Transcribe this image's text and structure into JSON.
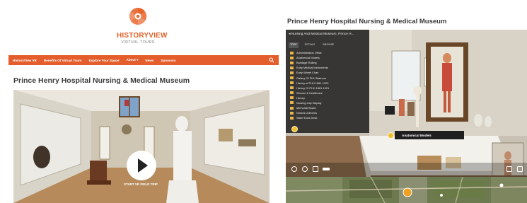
{
  "left": {
    "logo": {
      "name": "HISTORYVIEW",
      "tagline": "VIRTUAL TOURS"
    },
    "nav": {
      "items": [
        "HistoryView VR",
        "Benefits Of Virtual Tours",
        "Explore Your Space",
        "About",
        "News",
        "Sponsors"
      ],
      "about_caret": "▾"
    },
    "page_title": "Prince Henry Hospital Nursing & Medical Museum",
    "video": {
      "start_label": "START VR FIELD TRIP"
    }
  },
  "right": {
    "page_title": "Prince Henry Hospital Nursing & Medical Museum",
    "menu": {
      "header": "Nursing And Medical Museum, Prince H...",
      "tabs": [
        "TREE",
        "DETAILS",
        "BROWSE"
      ],
      "items": [
        "Administration Office",
        "Anatomical Models",
        "Bandage Rolling",
        "Early Medical Instruments",
        "Early Wheel Chair",
        "Gallery Of PHH Matrons",
        "History of PHH 1881-1920",
        "History Of PHH 1881-1921",
        "Women & Healthcare",
        "Library",
        "Nursing Cap Display",
        "Memorial Board",
        "Nurses Uniforms",
        "Sister Dora Desk"
      ]
    },
    "tooltip": "Anatomical Models"
  },
  "colors": {
    "brand_orange": "#e35e2c",
    "menu_bg": "#1e1e1e",
    "folder": "#e7b54a"
  }
}
